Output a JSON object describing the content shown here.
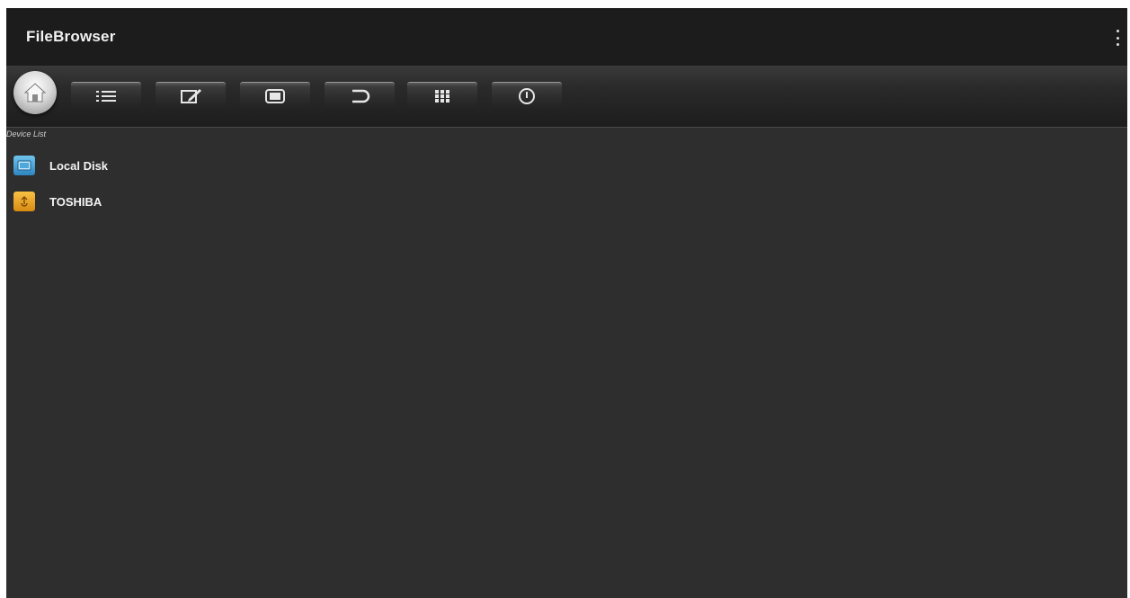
{
  "app": {
    "title": "FileBrowser"
  },
  "toolbar": {
    "buttons": [
      {
        "name": "home",
        "icon": "home-icon"
      },
      {
        "name": "list-view",
        "icon": "list-icon"
      },
      {
        "name": "edit",
        "icon": "edit-icon"
      },
      {
        "name": "window",
        "icon": "window-icon"
      },
      {
        "name": "back",
        "icon": "return-icon"
      },
      {
        "name": "grid-view",
        "icon": "grid-icon"
      },
      {
        "name": "power",
        "icon": "power-icon"
      }
    ]
  },
  "section": {
    "label": "Device List"
  },
  "devices": [
    {
      "label": "Local Disk",
      "icon": "local-disk-icon",
      "color": "#2e86c1"
    },
    {
      "label": "TOSHIBA",
      "icon": "usb-drive-icon",
      "color": "#d98a12"
    }
  ],
  "colors": {
    "background": "#2e2e2e",
    "titlebar": "#1c1c1c",
    "text": "#f4f4f4"
  }
}
